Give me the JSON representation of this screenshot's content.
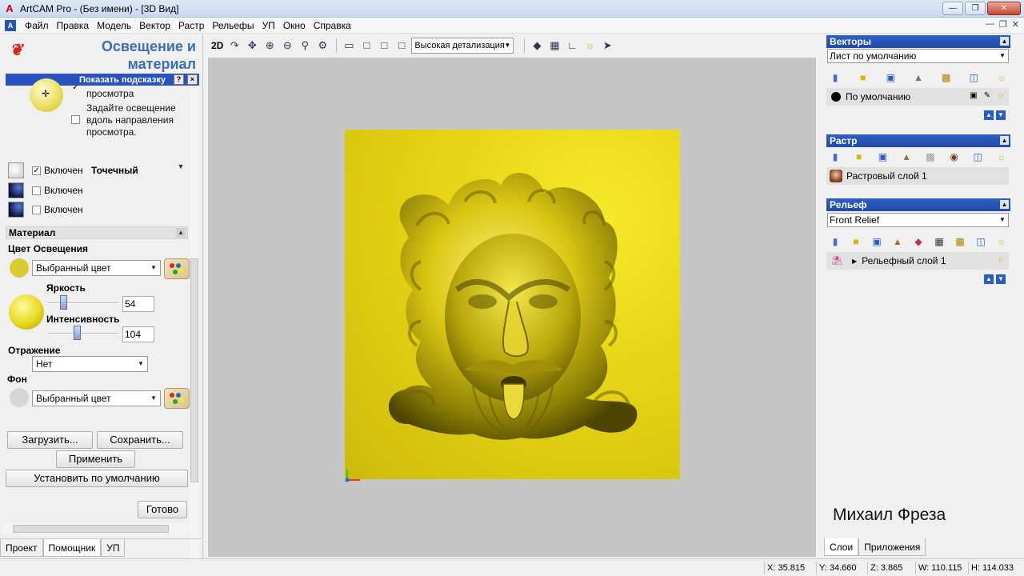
{
  "window": {
    "title": "ArtCAM Pro - (Без имени) - [3D Вид]",
    "app_icon": "artcam-logo-icon"
  },
  "menu": {
    "items": [
      "Файл",
      "Правка",
      "Модель",
      "Вектор",
      "Растр",
      "Рельефы",
      "УП",
      "Окно",
      "Справка"
    ]
  },
  "left_panel": {
    "title_line1": "Освещение и",
    "title_line2": "материал",
    "hint_label": "Показать подсказку",
    "hint_help": "?",
    "hint_close": "×",
    "view_text_fragment": "просмотра",
    "directional_text_1": "Задайте освещение",
    "directional_text_2": "вдоль направления",
    "directional_text_3": "просмотра.",
    "lights": [
      {
        "label": "Включен",
        "checked": true,
        "type": "Точечный"
      },
      {
        "label": "Включен",
        "checked": false
      },
      {
        "label": "Включен",
        "checked": false
      }
    ],
    "material_header": "Материал",
    "light_color_label": "Цвет Освещения",
    "light_color_value": "Выбранный цвет",
    "light_color_swatch": "#d8cc30",
    "brightness_label": "Яркость",
    "brightness_value": "54",
    "brightness_level": 54,
    "intensity_label": "Интенсивность",
    "intensity_value": "104",
    "intensity_level": 104,
    "reflection_label": "Отражение",
    "reflection_value": "Нет",
    "background_label": "Фон",
    "background_value": "Выбранный цвет",
    "background_swatch": "#d6d6d6",
    "load_button": "Загрузить...",
    "save_button": "Сохранить...",
    "apply_button": "Применить",
    "default_button": "Установить по умолчанию",
    "done_button": "Готово",
    "tabs": [
      "Проект",
      "Помощник",
      "УП"
    ],
    "active_tab": "Помощник"
  },
  "toolbar": {
    "mode_2d": "2D",
    "detail_select": "Высокая детализация"
  },
  "viewport": {
    "background": "#c6c6c6",
    "relief_color": "#e6d415",
    "content": "3D relief of a bearded face with curly hair"
  },
  "right_panel": {
    "vectors_header": "Векторы",
    "vectors_sheet": "Лист по умолчанию",
    "vectors_layer": "По умолчанию",
    "raster_header": "Растр",
    "raster_layer": "Растровый слой 1",
    "relief_header": "Рельеф",
    "relief_select": "Front Relief",
    "relief_layer": "Рельефный слой 1",
    "watermark": "Михаил Фреза",
    "tabs": [
      "Слои",
      "Приложения"
    ],
    "active_tab": "Слои"
  },
  "statusbar": {
    "x": "X: 35.815",
    "y": "Y: 34.660",
    "z": "Z: 3.865",
    "w": "W: 110.115",
    "h": "H: 114.033"
  }
}
